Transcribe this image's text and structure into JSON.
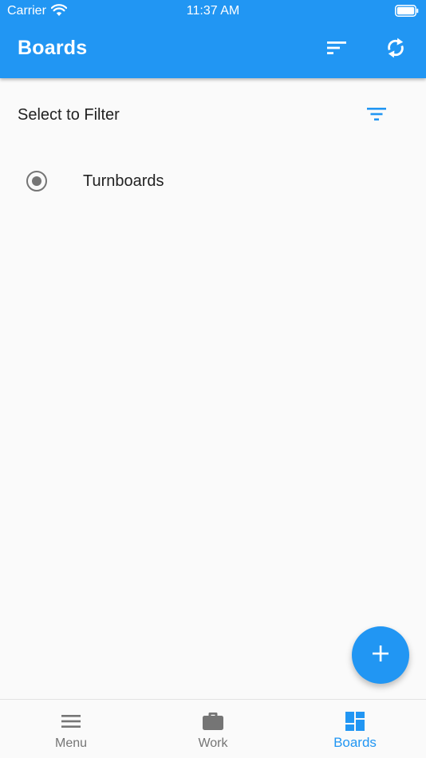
{
  "status_bar": {
    "carrier": "Carrier",
    "time": "11:37 AM"
  },
  "app_bar": {
    "title": "Boards",
    "background_color": "#2196f3",
    "actions": [
      {
        "icon": "sort-icon"
      },
      {
        "icon": "sync-icon"
      }
    ]
  },
  "filter": {
    "label": "Select to Filter",
    "icon": "filter-list-icon",
    "icon_color": "#2196f3"
  },
  "boards": [
    {
      "label": "Turnboards",
      "selected": true
    }
  ],
  "fab": {
    "icon": "add-icon",
    "color": "#2196f3"
  },
  "bottom_nav": {
    "items": [
      {
        "label": "Menu",
        "icon": "menu-icon",
        "active": false
      },
      {
        "label": "Work",
        "icon": "briefcase-icon",
        "active": false
      },
      {
        "label": "Boards",
        "icon": "dashboard-icon",
        "active": true
      }
    ],
    "active_color": "#2196f3",
    "inactive_color": "#757575"
  }
}
